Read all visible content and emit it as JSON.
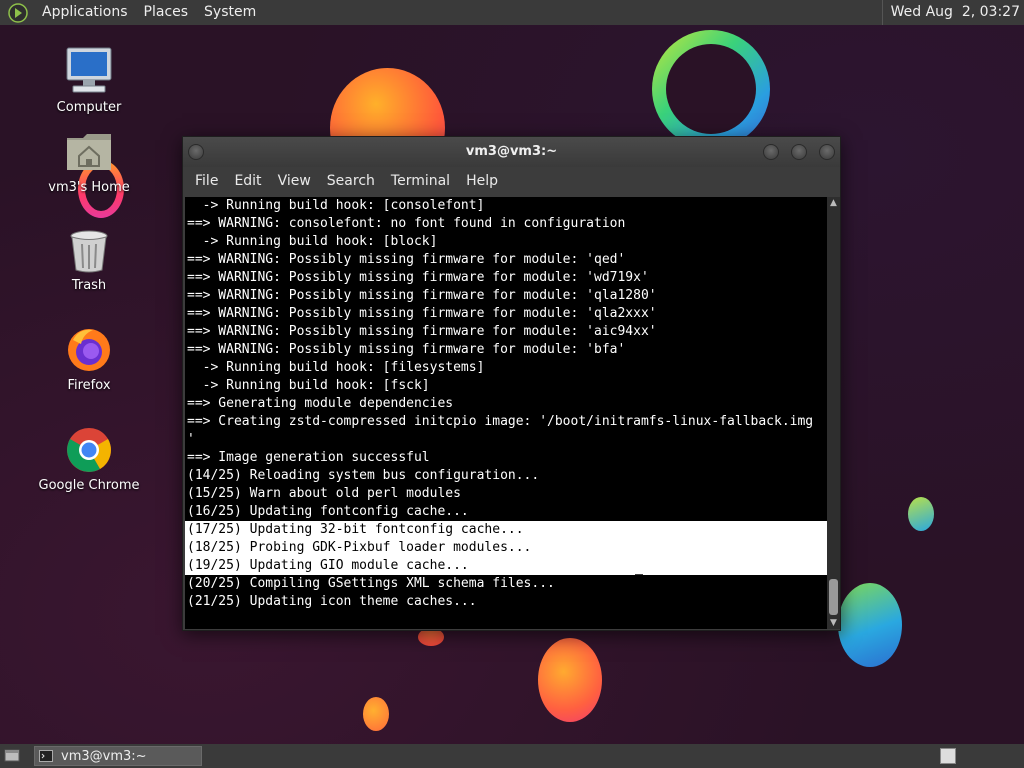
{
  "top_panel": {
    "menus": [
      "Applications",
      "Places",
      "System"
    ],
    "clock": "Wed Aug  2, 03:27"
  },
  "desktop": {
    "icons": [
      {
        "label": "Computer",
        "icon": "computer-icon"
      },
      {
        "label": "vm3's Home",
        "icon": "home-folder-icon"
      },
      {
        "label": "Trash",
        "icon": "trash-icon"
      },
      {
        "label": "Firefox",
        "icon": "firefox-icon"
      },
      {
        "label": "Google Chrome",
        "icon": "chrome-icon"
      }
    ]
  },
  "terminal": {
    "title": "vm3@vm3:~",
    "menu": [
      "File",
      "Edit",
      "View",
      "Search",
      "Terminal",
      "Help"
    ],
    "lines": [
      "  -> Running build hook: [consolefont]",
      "==> WARNING: consolefont: no font found in configuration",
      "  -> Running build hook: [block]",
      "==> WARNING: Possibly missing firmware for module: 'qed'",
      "==> WARNING: Possibly missing firmware for module: 'wd719x'",
      "==> WARNING: Possibly missing firmware for module: 'qla1280'",
      "==> WARNING: Possibly missing firmware for module: 'qla2xxx'",
      "==> WARNING: Possibly missing firmware for module: 'aic94xx'",
      "==> WARNING: Possibly missing firmware for module: 'bfa'",
      "  -> Running build hook: [filesystems]",
      "  -> Running build hook: [fsck]",
      "==> Generating module dependencies",
      "==> Creating zstd-compressed initcpio image: '/boot/initramfs-linux-fallback.img",
      "'",
      "==> Image generation successful",
      "(14/25) Reloading system bus configuration...",
      "(15/25) Warn about old perl modules",
      "(16/25) Updating fontconfig cache...",
      "(17/25) Updating 32-bit fontconfig cache...",
      "(18/25) Probing GDK-Pixbuf loader modules...",
      "(19/25) Updating GIO module cache...",
      "(20/25) Compiling GSettings XML schema files...",
      "(21/25) Updating icon theme caches..."
    ],
    "selected_from": 18,
    "selected_to": 21
  },
  "bottom_panel": {
    "task_label": "vm3@vm3:~"
  },
  "colors": {
    "panel": "#3a3a3a",
    "terminal_bg": "#000000",
    "terminal_fg": "#ffffff",
    "selection_bg": "#ffffff"
  }
}
